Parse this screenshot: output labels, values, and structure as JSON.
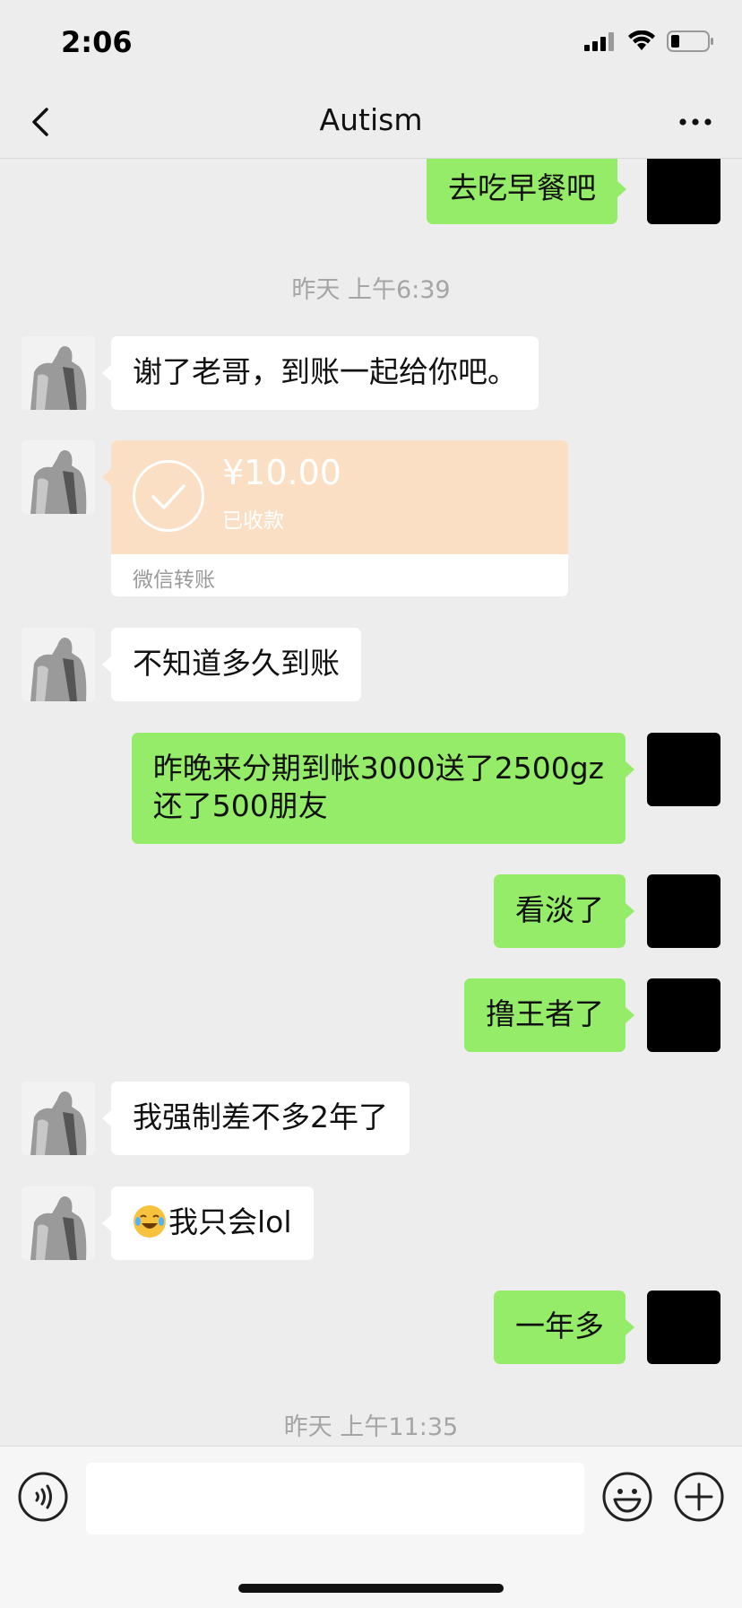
{
  "status_bar": {
    "time": "2:06"
  },
  "nav": {
    "title": "Autism"
  },
  "timestamps": [
    "昨天 上午6:39",
    "昨天 上午11:35"
  ],
  "messages": [
    {
      "from": "me",
      "text": "去吃早餐吧"
    },
    {
      "from": "friend",
      "text": "谢了老哥，到账一起给你吧。"
    },
    {
      "from": "friend",
      "type": "transfer",
      "amount": "¥10.00",
      "status": "已收款",
      "footer": "微信转账"
    },
    {
      "from": "friend",
      "text": "不知道多久到账"
    },
    {
      "from": "me",
      "lines": [
        "昨晚来分期到帐3000送了2500gz",
        "还了500朋友"
      ]
    },
    {
      "from": "me",
      "text": "看淡了"
    },
    {
      "from": "me",
      "text": "撸王者了"
    },
    {
      "from": "friend",
      "text": "我强制差不多2年了"
    },
    {
      "from": "friend",
      "emoji": "crying-laughing",
      "text": "我只会lol"
    },
    {
      "from": "me",
      "text": "一年多"
    }
  ],
  "input": {
    "placeholder": ""
  },
  "colors": {
    "bubble_me": "#95ec69",
    "bubble_friend": "#ffffff",
    "transfer": "#fbdfc4",
    "background": "#ededed"
  }
}
